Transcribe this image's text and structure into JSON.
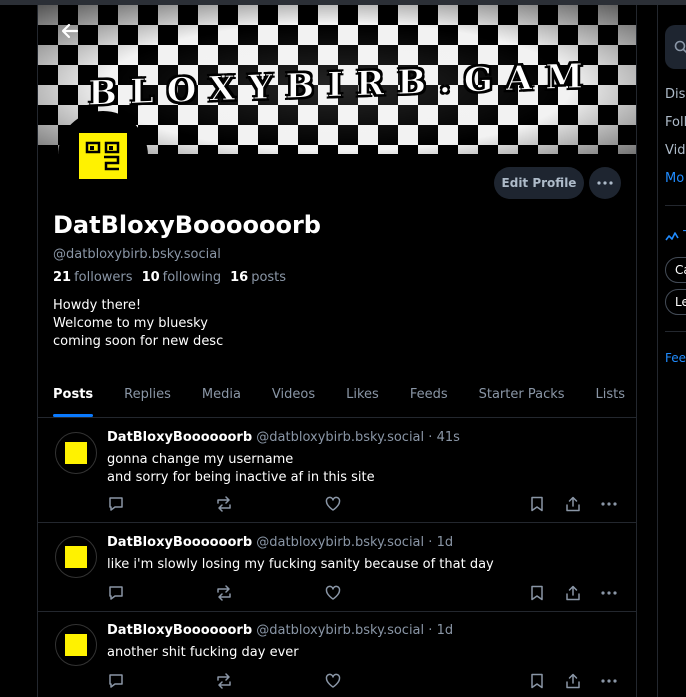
{
  "profile": {
    "banner_text": "BLOXYBIRB.GAM",
    "display_name": "DatBloxyBoooooorb",
    "handle": "@datbloxybirb.bsky.social",
    "followers_count": "21",
    "followers_label": "followers",
    "following_count": "10",
    "following_label": "following",
    "posts_count": "16",
    "posts_label": "posts",
    "bio": [
      "Howdy there!",
      "Welcome to my bluesky",
      "coming soon for new desc"
    ],
    "edit_button": "Edit Profile"
  },
  "tabs": [
    "Posts",
    "Replies",
    "Media",
    "Videos",
    "Likes",
    "Feeds",
    "Starter Packs",
    "Lists"
  ],
  "posts": [
    {
      "name": "DatBloxyBoooooorb",
      "handle": "@datbloxybirb.bsky.social",
      "time": "41s",
      "lines": [
        "gonna change my username",
        "and sorry for being inactive af in this site"
      ]
    },
    {
      "name": "DatBloxyBoooooorb",
      "handle": "@datbloxybirb.bsky.social",
      "time": "1d",
      "lines": [
        "like i'm slowly losing my fucking sanity because of that day"
      ]
    },
    {
      "name": "DatBloxyBoooooorb",
      "handle": "@datbloxybirb.bsky.social",
      "time": "1d",
      "lines": [
        "another shit fucking day ever"
      ]
    }
  ],
  "right": {
    "links": [
      "Disc",
      "Foll",
      "Vid",
      "Mo"
    ],
    "trending_label": "T",
    "chips": [
      "Ca",
      "Le"
    ],
    "feedback": "Feed"
  },
  "icons": {
    "back": "arrow-left-icon",
    "more": "ellipsis-icon",
    "reply": "reply-icon",
    "repost": "repost-icon",
    "like": "heart-icon",
    "bookmark": "bookmark-icon",
    "share": "share-icon",
    "search": "search-icon",
    "trending": "trending-icon"
  },
  "colors": {
    "background": "#000000",
    "accent": "#0a7aff",
    "link": "#208bfe",
    "muted_text": "#8a96a6",
    "button_bg": "#1e2530",
    "avatar_yellow": "#fff200"
  }
}
